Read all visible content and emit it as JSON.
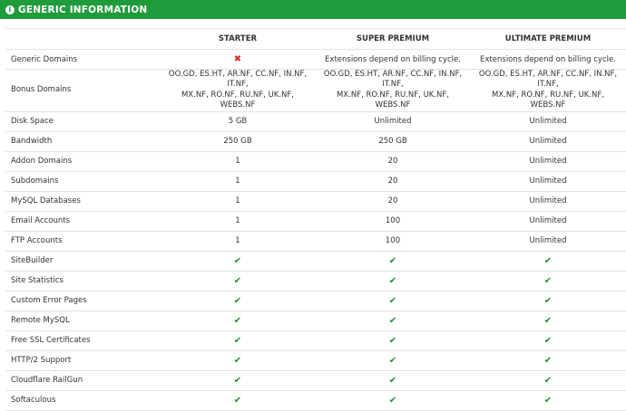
{
  "header": {
    "title": "GENERIC INFORMATION",
    "icon": "info-icon"
  },
  "columns": [
    "",
    "STARTER",
    "SUPER PREMIUM",
    "ULTIMATE PREMIUM"
  ],
  "rows": [
    {
      "label": "Generic Domains",
      "cells": [
        {
          "type": "cross"
        },
        {
          "type": "text",
          "text": "Extensions depend on billing cycle."
        },
        {
          "type": "text",
          "text": "Extensions depend on billing cycle."
        }
      ]
    },
    {
      "label": "Bonus Domains",
      "tall": true,
      "cells": [
        {
          "type": "text",
          "lines": [
            "OO.GD, ES.HT, AR.NF, CC.NF, IN.NF, IT.NF,",
            "MX.NF, RO.NF, RU.NF, UK.NF, WEBS.NF"
          ]
        },
        {
          "type": "text",
          "lines": [
            "OO.GD, ES.HT, AR.NF, CC.NF, IN.NF, IT.NF,",
            "MX.NF, RO.NF, RU.NF, UK.NF, WEBS.NF"
          ]
        },
        {
          "type": "text",
          "lines": [
            "OO.GD, ES.HT, AR.NF, CC.NF, IN.NF, IT.NF,",
            "MX.NF, RO.NF, RU.NF, UK.NF, WEBS.NF"
          ]
        }
      ]
    },
    {
      "label": "Disk Space",
      "cells": [
        {
          "type": "text",
          "text": "5 GB"
        },
        {
          "type": "text",
          "text": "Unlimited"
        },
        {
          "type": "text",
          "text": "Unlimited"
        }
      ]
    },
    {
      "label": "Bandwidth",
      "cells": [
        {
          "type": "text",
          "text": "250 GB"
        },
        {
          "type": "text",
          "text": "250 GB"
        },
        {
          "type": "text",
          "text": "Unlimited"
        }
      ]
    },
    {
      "label": "Addon Domains",
      "cells": [
        {
          "type": "text",
          "text": "1"
        },
        {
          "type": "text",
          "text": "20"
        },
        {
          "type": "text",
          "text": "Unlimited"
        }
      ]
    },
    {
      "label": "Subdomains",
      "cells": [
        {
          "type": "text",
          "text": "1"
        },
        {
          "type": "text",
          "text": "20"
        },
        {
          "type": "text",
          "text": "Unlimited"
        }
      ]
    },
    {
      "label": "MySQL Databases",
      "cells": [
        {
          "type": "text",
          "text": "1"
        },
        {
          "type": "text",
          "text": "20"
        },
        {
          "type": "text",
          "text": "Unlimited"
        }
      ]
    },
    {
      "label": "Email Accounts",
      "cells": [
        {
          "type": "text",
          "text": "1"
        },
        {
          "type": "text",
          "text": "100"
        },
        {
          "type": "text",
          "text": "Unlimited"
        }
      ]
    },
    {
      "label": "FTP Accounts",
      "cells": [
        {
          "type": "text",
          "text": "1"
        },
        {
          "type": "text",
          "text": "100"
        },
        {
          "type": "text",
          "text": "Unlimited"
        }
      ]
    },
    {
      "label": "SiteBuilder",
      "cells": [
        {
          "type": "check"
        },
        {
          "type": "check"
        },
        {
          "type": "check"
        }
      ]
    },
    {
      "label": "Site Statistics",
      "cells": [
        {
          "type": "check"
        },
        {
          "type": "check"
        },
        {
          "type": "check"
        }
      ]
    },
    {
      "label": "Custom Error Pages",
      "cells": [
        {
          "type": "check"
        },
        {
          "type": "check"
        },
        {
          "type": "check"
        }
      ]
    },
    {
      "label": "Remote MySQL",
      "cells": [
        {
          "type": "check"
        },
        {
          "type": "check"
        },
        {
          "type": "check"
        }
      ]
    },
    {
      "label": "Free SSL Certificates",
      "cells": [
        {
          "type": "check"
        },
        {
          "type": "check"
        },
        {
          "type": "check"
        }
      ]
    },
    {
      "label": "HTTP/2 Support",
      "cells": [
        {
          "type": "check"
        },
        {
          "type": "check"
        },
        {
          "type": "check"
        }
      ]
    },
    {
      "label": "Cloudflare RailGun",
      "cells": [
        {
          "type": "check"
        },
        {
          "type": "check"
        },
        {
          "type": "check"
        }
      ]
    },
    {
      "label": "Softaculous",
      "cells": [
        {
          "type": "check"
        },
        {
          "type": "check"
        },
        {
          "type": "check"
        }
      ]
    }
  ],
  "colors": {
    "header_bg": "#1f9b3b",
    "check": "#1e8f35",
    "cross": "#d32f2f"
  }
}
